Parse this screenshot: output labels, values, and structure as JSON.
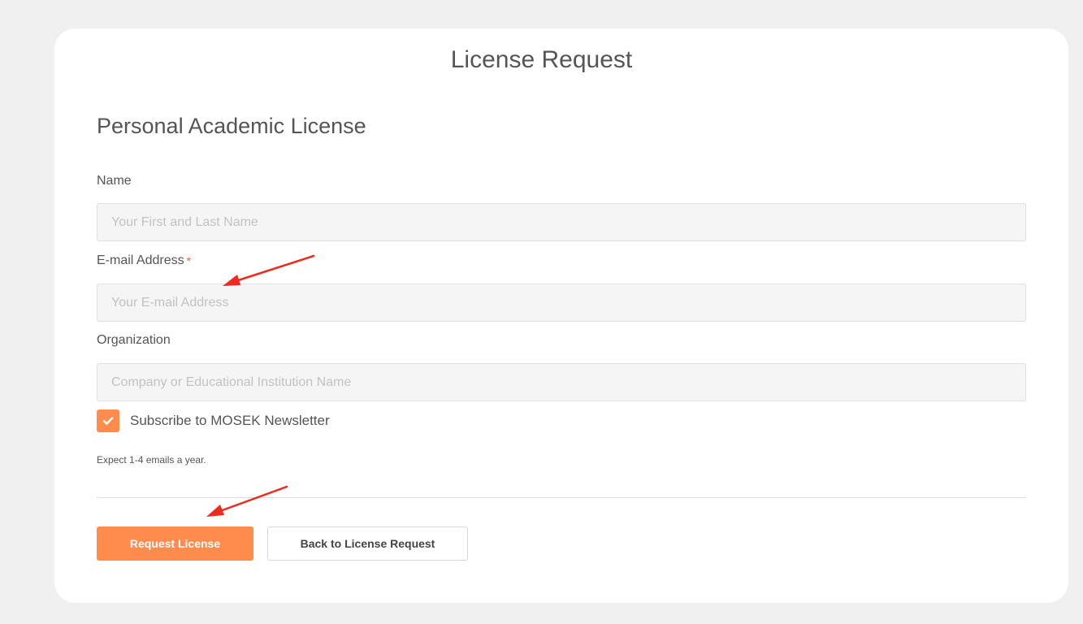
{
  "page": {
    "title": "License Request"
  },
  "form": {
    "section_title": "Personal Academic License",
    "name": {
      "label": "Name",
      "placeholder": "Your First and Last Name",
      "value": ""
    },
    "email": {
      "label": "E-mail Address",
      "required_mark": "*",
      "placeholder": "Your E-mail Address",
      "value": ""
    },
    "organization": {
      "label": "Organization",
      "placeholder": "Company or Educational Institution Name",
      "value": ""
    },
    "newsletter": {
      "label": "Subscribe to MOSEK Newsletter",
      "checked": true,
      "hint": "Expect 1-4 emails a year."
    },
    "buttons": {
      "submit_label": "Request License",
      "back_label": "Back to License Request"
    }
  },
  "colors": {
    "accent": "#ff8c4c",
    "required": "#e8603c",
    "annotation_arrow": "#ee2a1e"
  },
  "icons": {
    "checkbox": "checkmark-icon",
    "annotations": "red-arrow-icon"
  }
}
